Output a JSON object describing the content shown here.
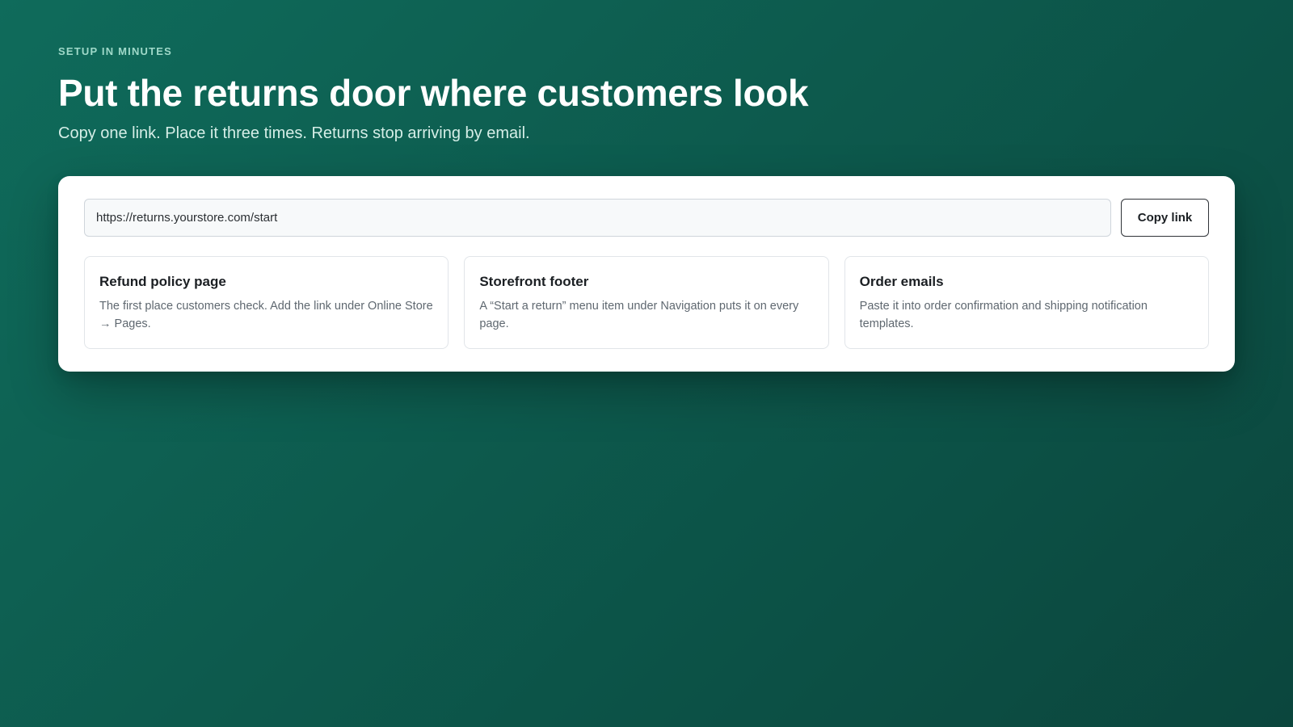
{
  "hero": {
    "eyebrow": "SETUP IN MINUTES",
    "title": "Put the returns door where customers look",
    "subtitle": "Copy one link. Place it three times. Returns stop arriving by email."
  },
  "link": {
    "value": "https://returns.yourstore.com/start",
    "copy_label": "Copy link"
  },
  "placements": [
    {
      "title": "Refund policy page",
      "description": "The first place customers check. Add the link under Online Store → Pages."
    },
    {
      "title": "Storefront footer",
      "description": "A “Start a return” menu item under Navigation puts it on every page."
    },
    {
      "title": "Order emails",
      "description": "Paste it into order confirmation and shipping notification templates."
    }
  ],
  "colors": {
    "background": "#0d5a4d",
    "eyebrow": "#9fd9c9",
    "card": "#ffffff"
  }
}
